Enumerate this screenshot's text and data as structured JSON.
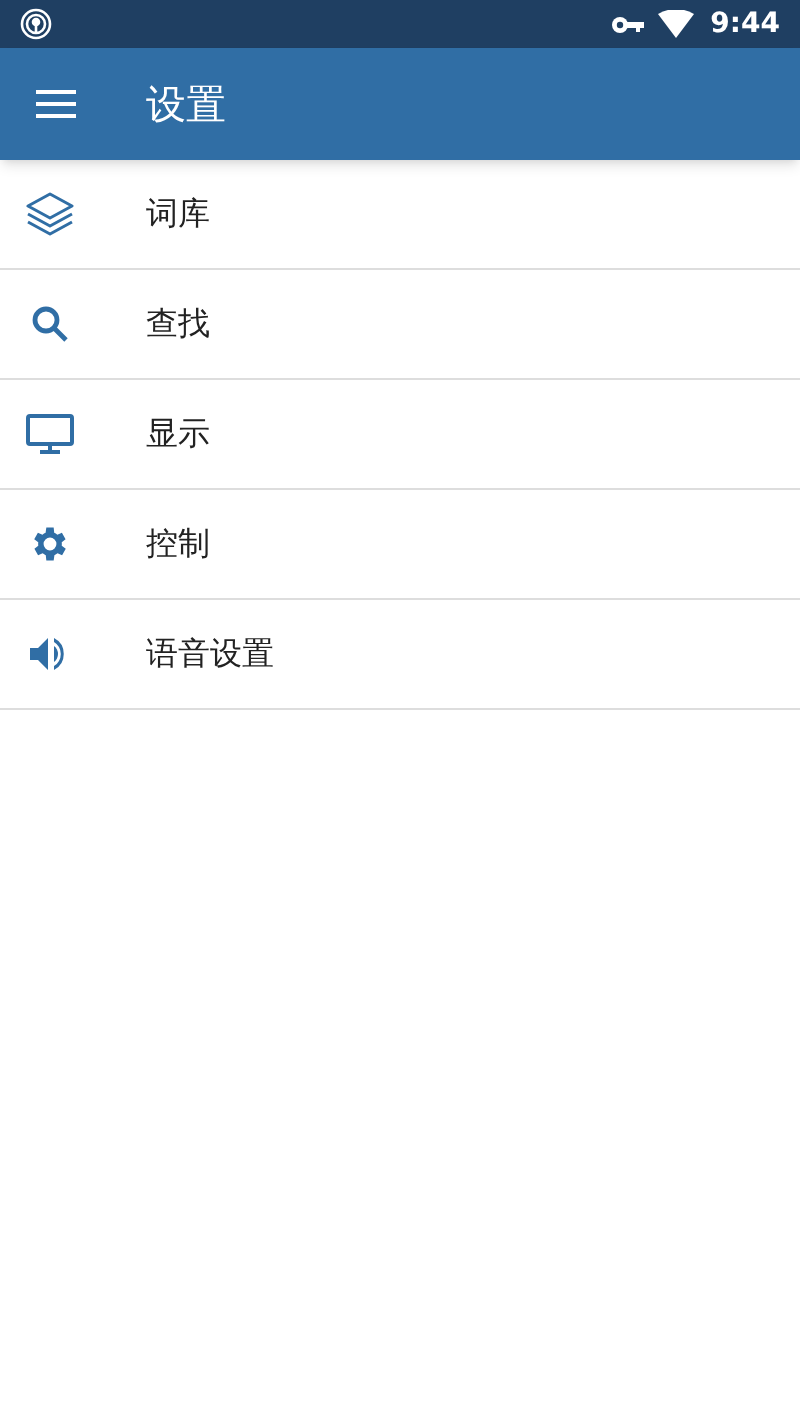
{
  "status_bar": {
    "time": "9:44"
  },
  "app_bar": {
    "title": "设置"
  },
  "menu": [
    {
      "kind": "layers",
      "label": "词库"
    },
    {
      "kind": "search",
      "label": "查找"
    },
    {
      "kind": "display",
      "label": "显示"
    },
    {
      "kind": "gear",
      "label": "控制"
    },
    {
      "kind": "speaker",
      "label": "语音设置"
    }
  ]
}
